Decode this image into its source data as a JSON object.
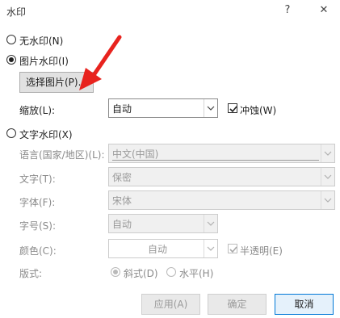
{
  "dialog": {
    "title": "水印",
    "help_glyph": "?",
    "close_glyph": "✕"
  },
  "options": {
    "no_watermark_label": "无水印(N)",
    "picture_watermark_label": "图片水印(I)",
    "text_watermark_label": "文字水印(X)",
    "selected": "picture"
  },
  "picture": {
    "select_picture_button": "选择图片(P)...",
    "scale_label": "缩放(L):",
    "scale_value": "自动",
    "washout_label": "冲蚀(W)",
    "washout_checked": true
  },
  "text": {
    "language_label": "语言(国家/地区)(L):",
    "language_value": "中文(中国)",
    "text_label": "文字(T):",
    "text_value": "保密",
    "font_label": "字体(F):",
    "font_value": "宋体",
    "size_label": "字号(S):",
    "size_value": "自动",
    "color_label": "颜色(C):",
    "color_value": "自动",
    "semitransparent_label": "半透明(E)",
    "semitransparent_checked": true,
    "layout_label": "版式:",
    "diagonal_label": "斜式(D)",
    "horizontal_label": "水平(H)",
    "layout_selected": "diagonal"
  },
  "buttons": {
    "apply": "应用(A)",
    "ok": "确定",
    "cancel": "取消"
  },
  "colors": {
    "annotation_arrow": "#e8231e",
    "focus_border": "#0078d7",
    "disabled_text": "#8a8a8a"
  },
  "icons": {
    "dropdown": "chevron-down-icon",
    "check": "check-icon",
    "arrow": "red-arrow-annotation"
  }
}
